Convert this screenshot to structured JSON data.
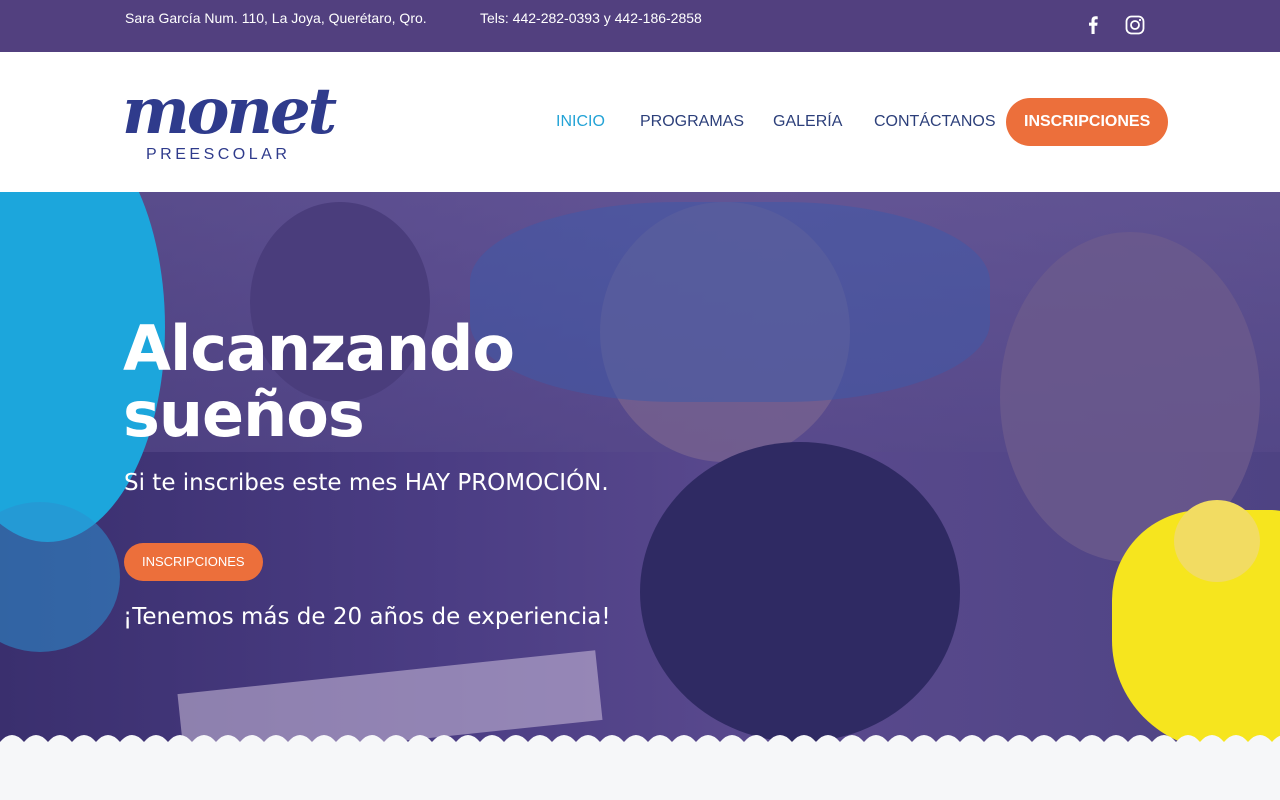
{
  "topbar": {
    "address": "Sara García Num. 110, La Joya, Querétaro, Qro.",
    "phones": "Tels: 442-282-0393 y 442-186-2858",
    "social": [
      {
        "icon": "facebook-icon"
      },
      {
        "icon": "instagram-icon"
      }
    ]
  },
  "logo": {
    "word": "monet",
    "sub": "PREESCOLAR"
  },
  "nav": {
    "items": [
      {
        "label": "INICIO",
        "active": true
      },
      {
        "label": "PROGRAMAS"
      },
      {
        "label": "GALERÍA"
      },
      {
        "label": "CONTÁCTANOS"
      }
    ],
    "cta": "INSCRIPCIONES"
  },
  "hero": {
    "title": "Alcanzando sueños",
    "subtitle": "Si te inscribes este mes HAY PROMOCIÓN.",
    "button": "INSCRIPCIONES",
    "experience": "¡Tenemos más de 20 años de experiencia!"
  },
  "colors": {
    "topbar": "#52407f",
    "nav_text": "#2c3f7a",
    "nav_active": "#23a3d6",
    "accent": "#ec6f3b",
    "blob_blue": "#1ca6dc",
    "blob_yellow": "#f6e51e"
  }
}
